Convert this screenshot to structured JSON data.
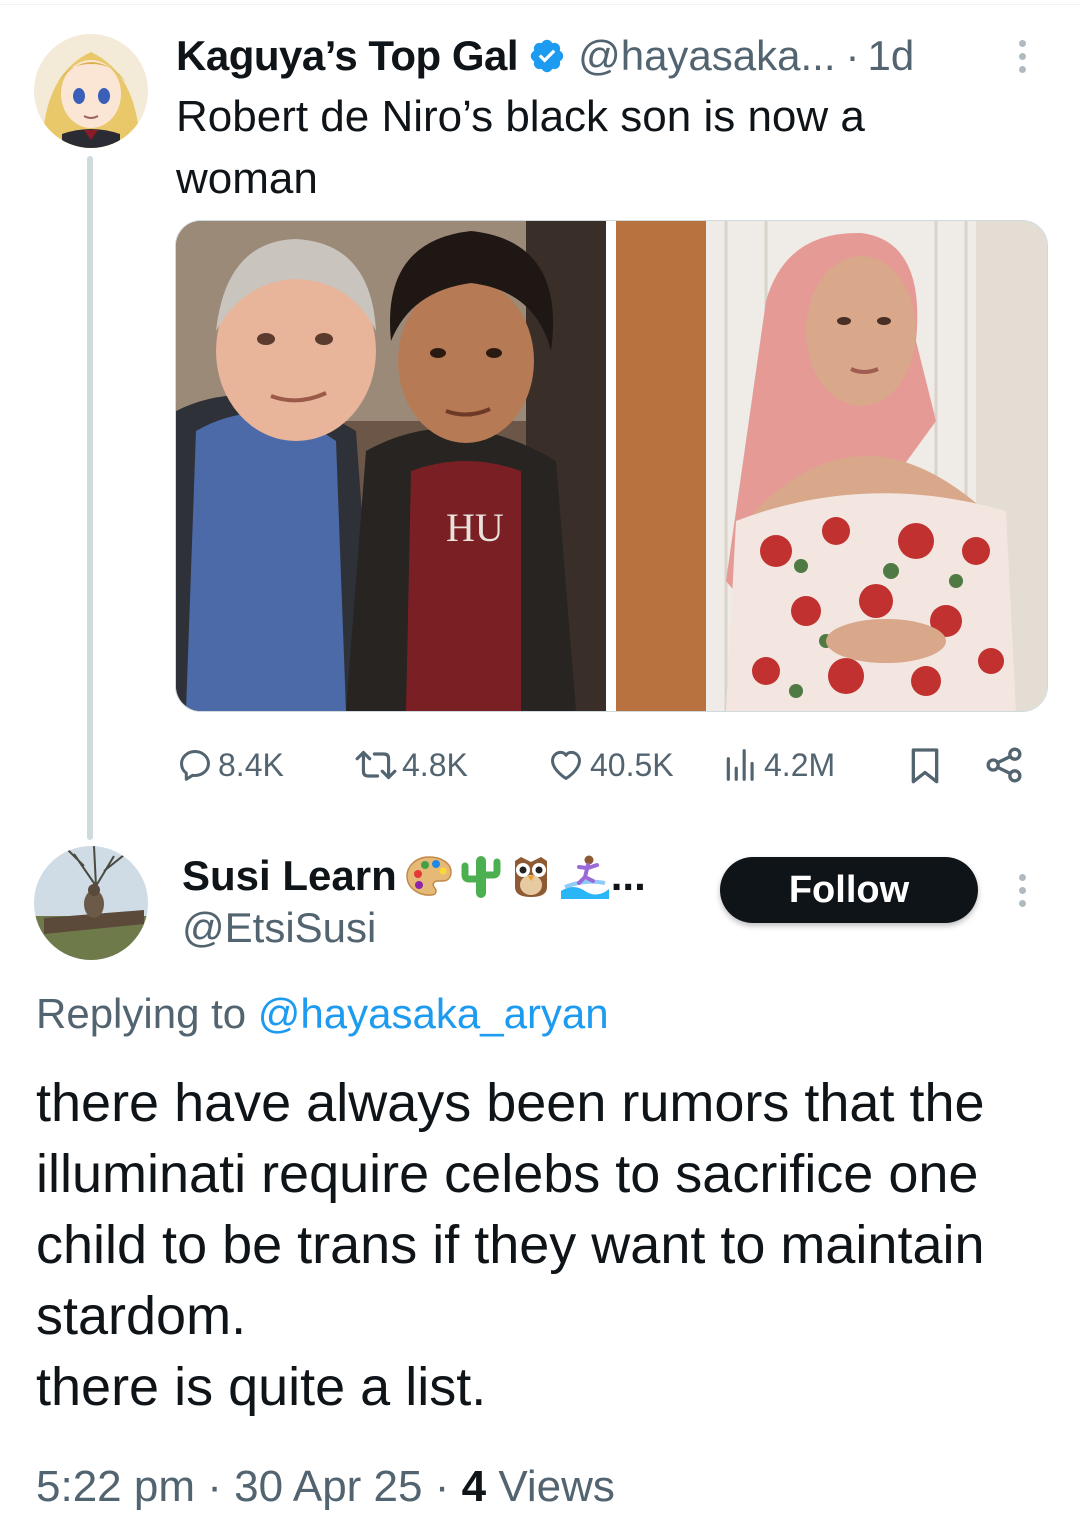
{
  "tweet": {
    "author_name": "Kaguya’s Top Gal",
    "author_handle": "@hayasaka...",
    "separator": "·",
    "time_ago": "1d",
    "text": "Robert de Niro’s black son is now a woman",
    "verified_color": "#1d9bf0",
    "stats": {
      "replies": "8.4K",
      "reposts": "4.8K",
      "likes": "40.5K",
      "views": "4.2M"
    }
  },
  "reply": {
    "author_name": "Susi Learn",
    "name_emojis": [
      "palette-emoji",
      "cactus-emoji",
      "owl-emoji",
      "surfer-emoji"
    ],
    "name_ellipsis": "...",
    "author_handle": "@EtsiSusi",
    "follow_label": "Follow",
    "replying_prefix": "Replying to",
    "replying_to": "@hayasaka_aryan",
    "text": "there have always been rumors that the illuminati require celebs to sacrifice one child to be trans if they want to maintain stardom.\nthere is quite a list.",
    "time": "5:22 pm",
    "date": "30 Apr 25",
    "views_count": "4",
    "views_label": "Views"
  },
  "colors": {
    "text_primary": "#0f1419",
    "text_secondary": "#536471",
    "link": "#1d9bf0",
    "thread_line": "#cfd9de"
  }
}
